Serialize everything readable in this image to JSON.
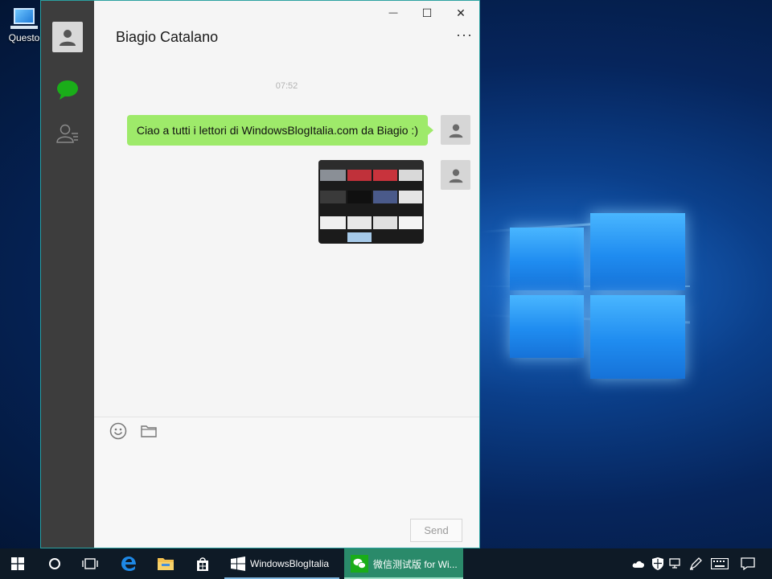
{
  "desktop": {
    "icon_label": "Questo"
  },
  "window": {
    "minimize_glyph": "—",
    "maximize_glyph": "☐",
    "close_glyph": "✕"
  },
  "rail": {
    "items": [
      "avatar-icon",
      "chat-icon",
      "contacts-icon"
    ],
    "active_color": "#1aad19"
  },
  "chat": {
    "contact_name": "Biagio Catalano",
    "more_glyph": "···",
    "timestamp": "07:52",
    "messages": [
      {
        "type": "text",
        "text": "Ciao a tutti i lettori di WindowsBlogItalia.com da Biagio :)",
        "bubble_color": "#9eea6a"
      },
      {
        "type": "image"
      }
    ]
  },
  "composer": {
    "tools": [
      "emoji-icon",
      "folder-icon"
    ],
    "send_label": "Send"
  },
  "taskbar": {
    "apps": [
      {
        "label": "WindowsBlogItalia"
      },
      {
        "label": "微信测试版 for Wi..."
      }
    ],
    "tray_icons": [
      "cloud-icon",
      "shield-icon",
      "network-icon",
      "pen-icon",
      "keyboard-icon",
      "notification-icon"
    ]
  }
}
